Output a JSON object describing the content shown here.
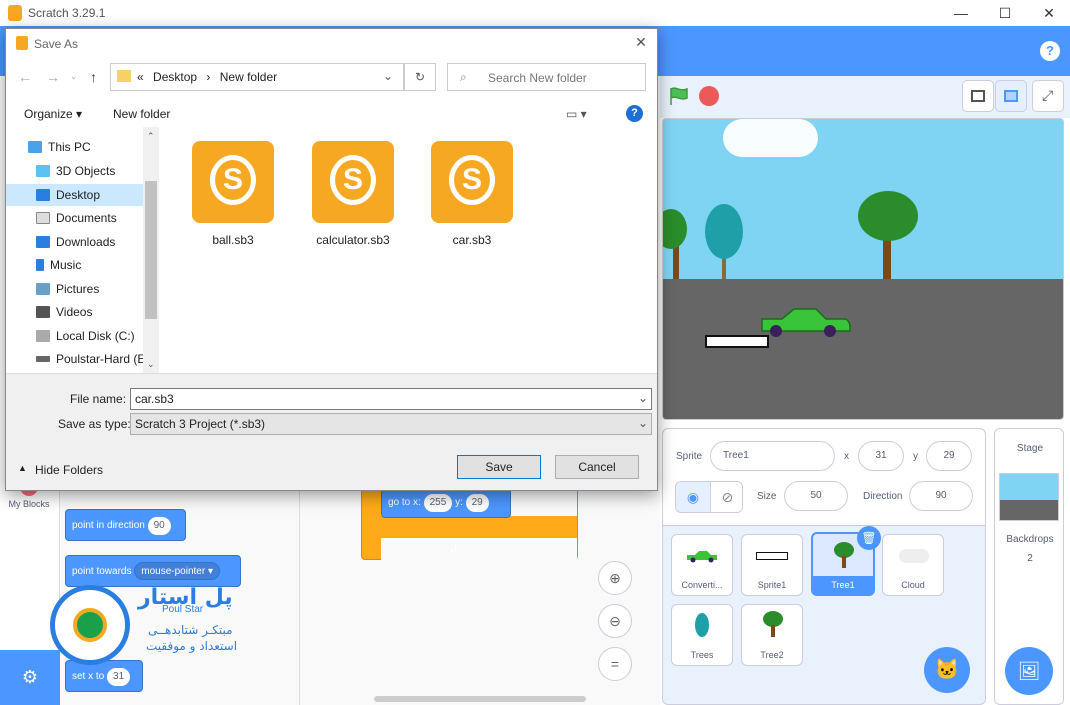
{
  "window": {
    "title": "Scratch 3.29.1",
    "min": "—",
    "max": "☐",
    "close": "✕"
  },
  "help": "?",
  "dialog": {
    "title": "Save As",
    "close": "✕",
    "breadcrumb": [
      "«",
      "Desktop",
      "›",
      "New folder"
    ],
    "search_placeholder": "Search New folder",
    "organize": "Organize ▾",
    "new_folder": "New folder",
    "nav": [
      {
        "label": "This PC",
        "icon": "computer-icon"
      },
      {
        "label": "3D Objects",
        "icon": "cube-icon"
      },
      {
        "label": "Desktop",
        "icon": "desktop-icon"
      },
      {
        "label": "Documents",
        "icon": "document-icon"
      },
      {
        "label": "Downloads",
        "icon": "download-icon"
      },
      {
        "label": "Music",
        "icon": "music-icon"
      },
      {
        "label": "Pictures",
        "icon": "picture-icon"
      },
      {
        "label": "Videos",
        "icon": "video-icon"
      },
      {
        "label": "Local Disk (C:)",
        "icon": "drive-icon"
      },
      {
        "label": "Poulstar-Hard (E",
        "icon": "drive-icon"
      }
    ],
    "files": [
      "ball.sb3",
      "calculator.sb3",
      "car.sb3"
    ],
    "file_name_label": "File name:",
    "file_name": "car.sb3",
    "type_label": "Save as type:",
    "type": "Scratch 3 Project (*.sb3)",
    "hide_folders": "Hide Folders",
    "save": "Save",
    "cancel": "Cancel"
  },
  "sprite_info": {
    "sprite_label": "Sprite",
    "name": "Tree1",
    "x_label": "x",
    "x": "31",
    "y_label": "y",
    "y": "29",
    "size_label": "Size",
    "size": "50",
    "direction_label": "Direction",
    "direction": "90"
  },
  "sprites": [
    "Converti...",
    "Sprite1",
    "Tree1",
    "Cloud",
    "Trees",
    "Tree2"
  ],
  "stage_pane": {
    "title": "Stage",
    "backdrops_label": "Backdrops",
    "backdrops": "2"
  },
  "palette": {
    "my_blocks": "My Blocks",
    "point_dir": "point in direction",
    "point_dir_val": "90",
    "point_towards": "point towards",
    "point_towards_val": "mouse-pointer ▾",
    "set_x": "set x to",
    "set_x_val": "31"
  },
  "script": {
    "goto": "go to x:",
    "x": "255",
    "y_label": "y:",
    "y": "29"
  },
  "watermark": {
    "brand": "Poul Star",
    "line1": "مبتکـر شتابدهــی",
    "line2": "استعداد و موفقیت"
  }
}
